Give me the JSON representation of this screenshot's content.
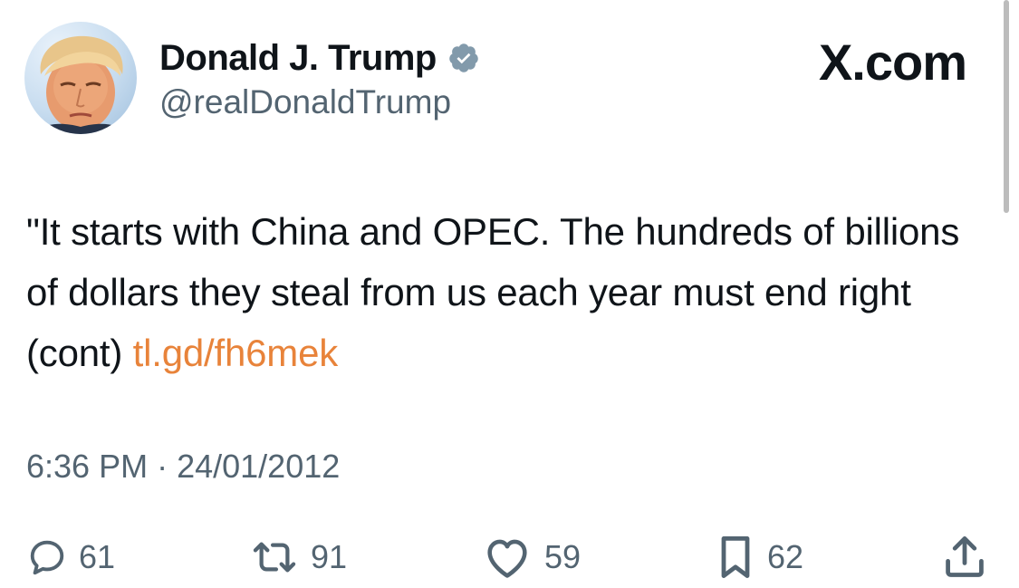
{
  "user": {
    "name": "Donald J. Trump",
    "handle": "@realDonaldTrump",
    "verified": true
  },
  "brand": "X.com",
  "tweet": {
    "text": "\"It starts with China and OPEC. The hundreds of billions of dollars they steal from us each year must end right (cont) ",
    "link": "tl.gd/fh6mek",
    "time": "6:36 PM",
    "separator": " · ",
    "date": "24/01/2012"
  },
  "actions": {
    "replies": "61",
    "reposts": "91",
    "likes": "59",
    "bookmarks": "62"
  },
  "icons": {
    "reply": "reply-icon",
    "repost": "repost-icon",
    "like": "heart-icon",
    "bookmark": "bookmark-icon",
    "share": "share-icon",
    "verified": "verified-badge-icon"
  },
  "colors": {
    "text": "#0f1419",
    "secondary": "#536471",
    "link": "#e8833a",
    "verified_badge": "#829aab"
  }
}
